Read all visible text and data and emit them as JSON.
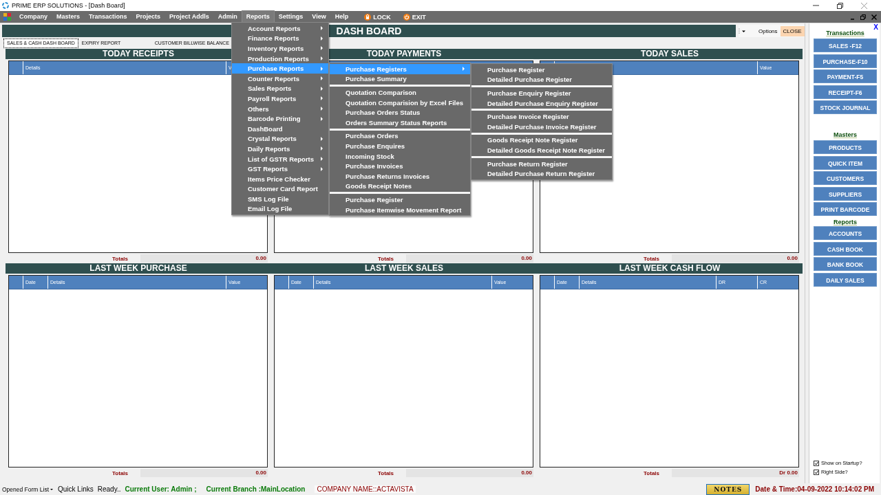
{
  "window": {
    "title": "PRIME ERP SOLUTIONS - [Dash Board]"
  },
  "menu_bar": [
    {
      "label": "Company",
      "selected": false
    },
    {
      "label": "Masters",
      "selected": false
    },
    {
      "label": "Transactions",
      "selected": false
    },
    {
      "label": "Projects",
      "selected": false
    },
    {
      "label": "Project Addls",
      "selected": false
    },
    {
      "label": "Admin",
      "selected": false
    },
    {
      "label": "Reports",
      "selected": true
    },
    {
      "label": "Settings",
      "selected": false
    },
    {
      "label": "View",
      "selected": false
    },
    {
      "label": "Help",
      "selected": false
    }
  ],
  "menu_actions": [
    {
      "label": "LOCK",
      "kind": "lock"
    },
    {
      "label": "EXIT",
      "kind": "exit"
    }
  ],
  "open_menus": [
    {
      "groups": [
        [
          {
            "label": "Account Reports",
            "submenu": true,
            "selected": false
          },
          {
            "label": "Finance Reports",
            "submenu": true,
            "selected": false
          },
          {
            "label": "Inventory Reports",
            "submenu": true,
            "selected": false
          },
          {
            "label": "Production Reports",
            "submenu": true,
            "selected": false
          },
          {
            "label": "Purchase Reports",
            "submenu": true,
            "selected": true
          },
          {
            "label": "Counter Reports",
            "submenu": true,
            "selected": false
          },
          {
            "label": "Sales Reports",
            "submenu": true,
            "selected": false
          },
          {
            "label": "Payroll Reports",
            "submenu": true,
            "selected": false
          },
          {
            "label": "Others",
            "submenu": true,
            "selected": false
          },
          {
            "label": "Barcode Printing",
            "submenu": true,
            "selected": false
          },
          {
            "label": "DashBoard",
            "submenu": false,
            "selected": false
          },
          {
            "label": "Crystal Reports",
            "submenu": true,
            "selected": false
          },
          {
            "label": "Daily Reports",
            "submenu": true,
            "selected": false
          },
          {
            "label": "List of GSTR Reports",
            "submenu": true,
            "selected": false
          },
          {
            "label": "GST Reports",
            "submenu": true,
            "selected": false
          },
          {
            "label": "Items Price Checker",
            "submenu": false,
            "selected": false
          },
          {
            "label": "Customer Card Report",
            "submenu": false,
            "selected": false
          },
          {
            "label": "SMS Log File",
            "submenu": false,
            "selected": false
          },
          {
            "label": "Email Log File",
            "submenu": false,
            "selected": false
          }
        ]
      ]
    },
    {
      "groups": [
        [
          {
            "label": "Purchase Registers",
            "submenu": true,
            "selected": true
          },
          {
            "label": "Purchase Summary",
            "submenu": false,
            "selected": false
          }
        ],
        [
          {
            "label": "Quotation Comparison",
            "submenu": false,
            "selected": false
          },
          {
            "label": "Quotation Comparision by Excel Files",
            "submenu": false,
            "selected": false
          },
          {
            "label": "Purchase Orders Status",
            "submenu": false,
            "selected": false
          },
          {
            "label": "Orders Summary Status Reports",
            "submenu": false,
            "selected": false
          }
        ],
        [
          {
            "label": "Purchase Orders",
            "submenu": false,
            "selected": false
          },
          {
            "label": "Purchase Enquires",
            "submenu": false,
            "selected": false
          },
          {
            "label": "Incoming Stock",
            "submenu": false,
            "selected": false
          },
          {
            "label": "Purchase Invoices",
            "submenu": false,
            "selected": false
          },
          {
            "label": "Purchase Returns Invoices",
            "submenu": false,
            "selected": false
          },
          {
            "label": "Goods Receipt Notes",
            "submenu": false,
            "selected": false
          }
        ],
        [
          {
            "label": "Purchase Register",
            "submenu": false,
            "selected": false
          },
          {
            "label": "Purchase Itemwise Movement Report",
            "submenu": false,
            "selected": false
          }
        ]
      ]
    },
    {
      "groups": [
        [
          {
            "label": "Purchase Register",
            "submenu": false,
            "selected": false
          },
          {
            "label": "Detailed Purchase Register",
            "submenu": false,
            "selected": false
          }
        ],
        [
          {
            "label": "Purchase Enquiry Register",
            "submenu": false,
            "selected": false
          },
          {
            "label": "Detailed Purchase Enquiry Register",
            "submenu": false,
            "selected": false
          }
        ],
        [
          {
            "label": "Purchase Invoice Register",
            "submenu": false,
            "selected": false
          },
          {
            "label": "Detailed Purchase Invoice Register",
            "submenu": false,
            "selected": false
          }
        ],
        [
          {
            "label": "Goods Receipt Note Register",
            "submenu": false,
            "selected": false
          },
          {
            "label": "Detailed Goods Receipt Note Register",
            "submenu": false,
            "selected": false
          }
        ],
        [
          {
            "label": "Purchase Return Register",
            "submenu": false,
            "selected": false
          },
          {
            "label": "Detailed Purchase Return Register",
            "submenu": false,
            "selected": false
          }
        ]
      ]
    }
  ],
  "dashboard": {
    "title": "DASH BOARD",
    "options": "Options",
    "close": "CLOSE",
    "tabs": [
      {
        "label": "SALES & CASH DASH BOARD",
        "selected": true
      },
      {
        "label": "EXPIRY REPORT",
        "selected": false
      },
      {
        "label": "CUSTOMER BILLWISE BALANCE",
        "selected": false
      }
    ],
    "panels": [
      {
        "title": "TODAY RECEIPTS",
        "columns": [
          {
            "label": "Details",
            "kind": "text"
          },
          {
            "label": "V",
            "kind": "amount"
          }
        ],
        "totals_label": "Totals",
        "total": "0.00"
      },
      {
        "title": "TODAY PAYMENTS",
        "totals_label": "Totals",
        "total": "0.00"
      },
      {
        "title": "TODAY SALES",
        "columns": [
          {
            "label": "Value",
            "kind": "amount"
          }
        ],
        "totals_label": "Totals",
        "total": "0.00"
      },
      {
        "title": "LAST WEEK PURCHASE",
        "columns": [
          {
            "label": "Date",
            "kind": "date"
          },
          {
            "label": "Details",
            "kind": "text"
          },
          {
            "label": "Value",
            "kind": "amount"
          }
        ],
        "totals_label": "Totals",
        "total": "0.00"
      },
      {
        "title": "LAST WEEK SALES",
        "columns": [
          {
            "label": "Date",
            "kind": "date"
          },
          {
            "label": "Details",
            "kind": "text"
          },
          {
            "label": "Value",
            "kind": "amount"
          }
        ],
        "totals_label": "Totals",
        "total": "0.00"
      },
      {
        "title": "LAST WEEK CASH FLOW",
        "columns": [
          {
            "label": "Date",
            "kind": "date"
          },
          {
            "label": "Details",
            "kind": "text"
          },
          {
            "label": "DR",
            "kind": "amount"
          },
          {
            "label": "CR",
            "kind": "amount"
          }
        ],
        "totals_label": "Totals",
        "total": "Dr 0.00"
      }
    ]
  },
  "side_panel": {
    "close": "X",
    "sections": [
      {
        "title": "Transactions",
        "buttons": [
          "SALES -F12",
          "PURCHASE-F10",
          "PAYMENT-F5",
          "RECEIPT-F6",
          "STOCK JOURNAL"
        ]
      },
      {
        "title": "Masters",
        "buttons": [
          "PRODUCTS",
          "QUICK ITEM",
          "CUSTOMERS",
          "SUPPLIERS",
          "PRINT BARCODE"
        ]
      },
      {
        "title": "Reports",
        "buttons": [
          "ACCOUNTS",
          "CASH BOOK",
          "BANK BOOK",
          "DAILY SALES"
        ]
      }
    ],
    "options": [
      {
        "label": "Show on Startup?",
        "checked": true
      },
      {
        "label": "Right Side?",
        "checked": true
      }
    ]
  },
  "status_bar": {
    "form_list": "Opened Form List",
    "quick_links": "Quick Links",
    "status": "Ready..",
    "user": "Current User: Admin ;",
    "branch": "Current Branch :MainLocation",
    "company": "COMPANY NAME::ACTAVISTA",
    "notes": "NOTES",
    "datetime": "Date & Time:04-09-2022 10:14:02 PM"
  }
}
